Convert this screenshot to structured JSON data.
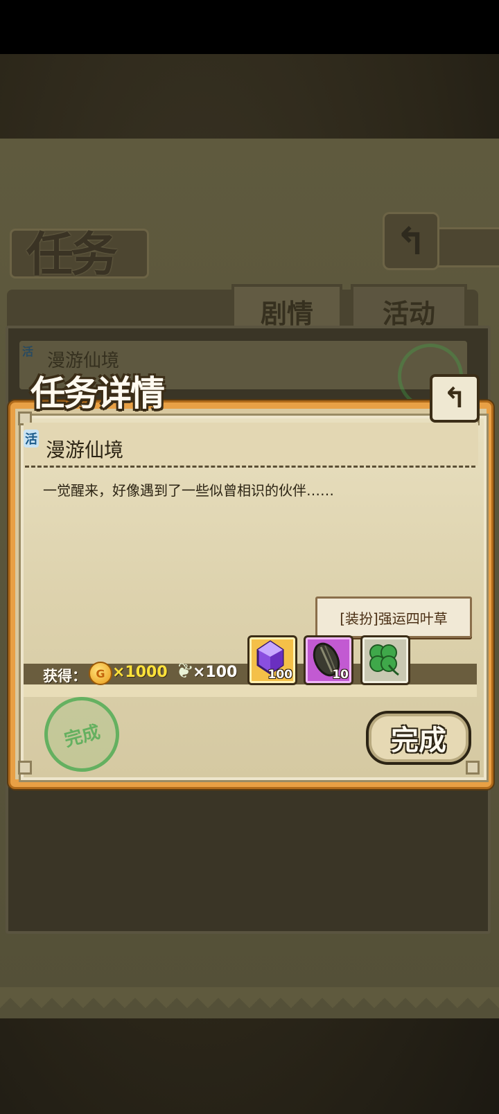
{
  "header": {
    "title": "任务",
    "back_icon": "return-arrow-icon"
  },
  "tabs": [
    {
      "label": "剧情"
    },
    {
      "label": "活动"
    }
  ],
  "list": {
    "items": [
      {
        "badge": "活",
        "name": "漫游仙境"
      }
    ]
  },
  "modal": {
    "title": "任务详情",
    "mission": {
      "badge": "活",
      "name": "漫游仙境",
      "description": "一觉醒来，好像遇到了一些似曾相识的伙伴……"
    },
    "rewards": {
      "label": "获得：",
      "coin_icon_letter": "G",
      "coin_value": "×1000",
      "feather_value": "×100",
      "items": [
        {
          "icon": "purple-crystal-icon",
          "count": "100"
        },
        {
          "icon": "seed-icon",
          "count": "10"
        },
        {
          "icon": "four-leaf-clover-icon",
          "count": ""
        }
      ]
    },
    "tooltip": "[装扮]强运四叶草",
    "stamp": "完成",
    "complete_button": "完成"
  },
  "colors": {
    "accent_orange": "#e8a045",
    "stamp_green": "#3fa84a",
    "coin_gold": "#ffe23a"
  }
}
